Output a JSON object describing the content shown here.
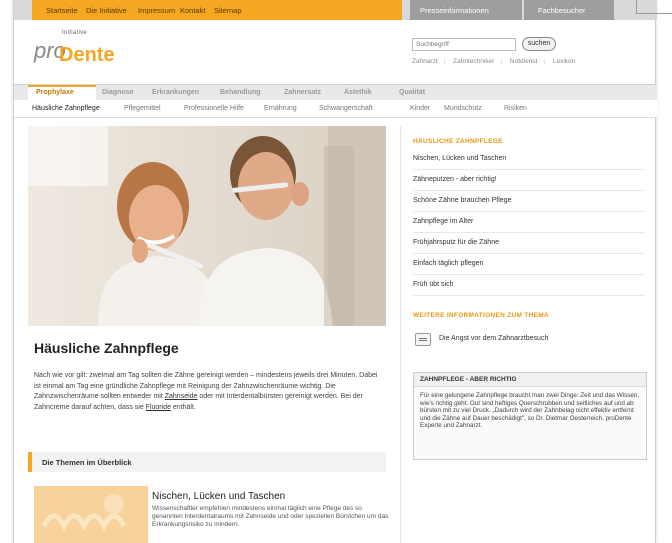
{
  "topbar": {
    "links": [
      "Startseite",
      "Die Initiative",
      "Impressum",
      "Kontakt",
      "Sitemap"
    ],
    "press": "Presseinformationen",
    "professional": "Fachbesucher"
  },
  "logo": {
    "initiative": "Initiative",
    "pro": "pro",
    "dente": "Dente"
  },
  "search": {
    "placeholder": "Suchbegriff",
    "button": "suchen",
    "quicklinks": [
      "Zahnarzt",
      "Zahntechniker",
      "Notdienst",
      "Lexikon"
    ]
  },
  "mainnav": [
    "Prophylaxe",
    "Diagnose",
    "Erkrankungen",
    "Behandlung",
    "Zahnersatz",
    "Ästethik",
    "Qualität"
  ],
  "subnav": [
    "Häusliche Zahnpflege",
    "Pflegemittel",
    "Professionelle Hilfe",
    "Ernährung",
    "Schwangerschaft",
    "Kinder",
    "Mundschutz",
    "Risiken"
  ],
  "main": {
    "title": "Häusliche Zahnpflege",
    "body_1": "Nach wie vor gilt: zweimal am Tag sollten die Zähne gereinigt werden – mindestens jeweils drei Minuten. Dabei ist einmal am Tag eine gründliche Zahnpflege mit Reinigung der Zahnzwischenräume wichtig. Die Zahnzwischenräume sollten  entweder mit ",
    "link_zahnseide": "Zahnseide",
    "body_2": " oder mit Interdentalbürsten gereinigt werden. Bei der Zahncreme darauf achten, dass sie ",
    "link_fluoride": "Fluoride",
    "body_3": " enthält.",
    "themen_heading": "Die Themen im Überblick",
    "teaser_title": "Nischen, Lücken und Taschen",
    "teaser_text": "Wissenschaftler empfehlen mindestens einmal täglich eine Pflege des so genannten Interdentalraums mit Zahnseide und oder speziellen Bürstchen um das Erkrankungsrisiko zu mindern."
  },
  "sidebar": {
    "heading": "HÄUSLICHE ZAHNPFLEGE",
    "items": [
      "Nischen, Lücken und Taschen",
      "Zähneputzen - aber richtig!",
      "Schöne Zähne brauchen Pflege",
      "Zahnpflege im Alter",
      "Frühjahrsputz für die Zähne",
      "Einfach täglich pflegen",
      "Früh übt sich"
    ],
    "more_heading": "WEITERE INFORMATIONEN ZUM THEMA",
    "doc_link": "Die Angst vor dem Zahnarztbesuch",
    "box_heading": "ZAHNPFLEGE - ABER RICHTIG",
    "box_text": "Für eine gelungene Zahnpflege braucht man zwei Dinge: Zeit und das Wissen, wie's richtig geht. Out sind heftiges Querschrubben und seitliches auf und ab bürsten mit zu viel Druck. „Dadurch wird der Zahnbelag nicht effektiv entfernt und die Zähne auf Dauer beschädigt\", so Dr. Dietmar Oesterreich, proDente Experte und Zahnarzt."
  },
  "colors": {
    "accent": "#f5a623",
    "accent_dark": "#c47a00"
  }
}
